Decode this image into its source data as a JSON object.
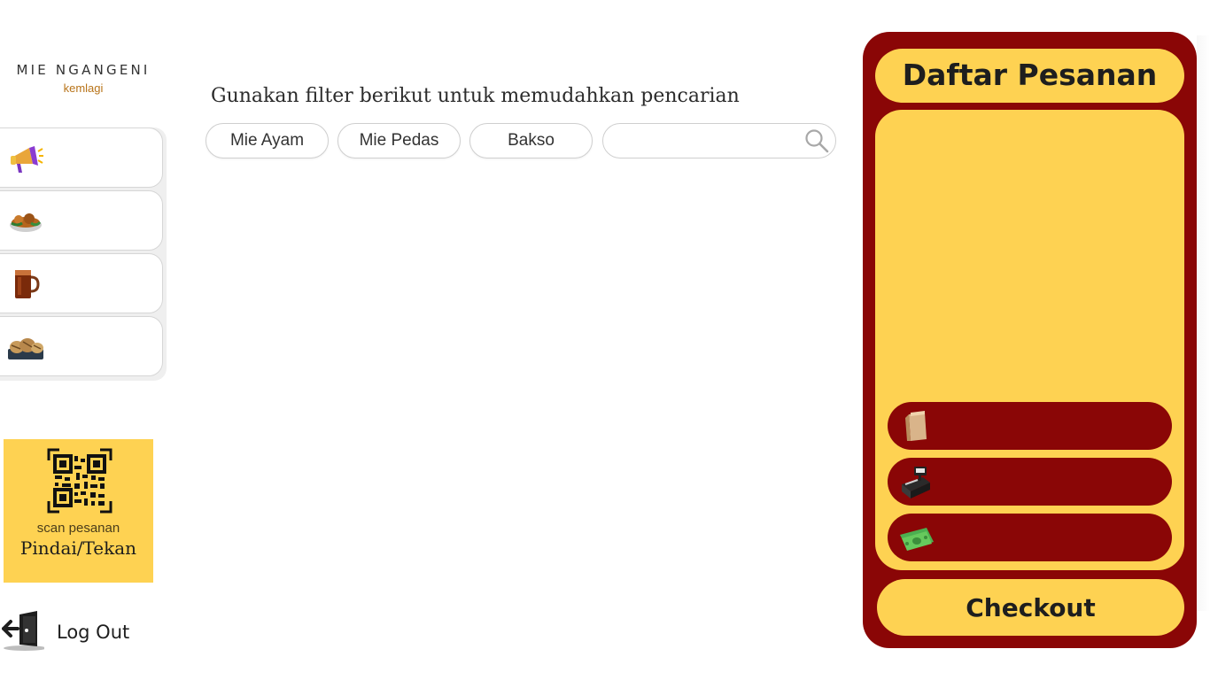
{
  "brand": {
    "name": "MIE NGANGENI",
    "tagline": "kemlagi"
  },
  "sidebar": {
    "categories": [
      {
        "icon": "megaphone-icon"
      },
      {
        "icon": "food-bowl-icon"
      },
      {
        "icon": "iced-tea-icon"
      },
      {
        "icon": "snack-platter-icon"
      }
    ],
    "qr": {
      "icon": "qr-code-icon",
      "caption": "scan pesanan",
      "action": "Pindai/Tekan"
    },
    "logout": {
      "icon": "door-exit-icon",
      "label": "Log Out"
    }
  },
  "filters": {
    "heading": "Gunakan filter berikut untuk memudahkan pencarian",
    "chips": [
      "Mie Ayam",
      "Mie Pedas",
      "Bakso"
    ],
    "search": {
      "value": "",
      "placeholder": "",
      "icon": "search-icon"
    }
  },
  "order": {
    "title": "Daftar Pesanan",
    "options": [
      {
        "icon": "paper-bag-icon"
      },
      {
        "icon": "cash-register-icon"
      },
      {
        "icon": "cash-money-icon"
      }
    ],
    "checkout_label": "Checkout"
  },
  "colors": {
    "accent": "#fed252",
    "panel": "#8a0606",
    "brand_sub": "#b8741a"
  }
}
